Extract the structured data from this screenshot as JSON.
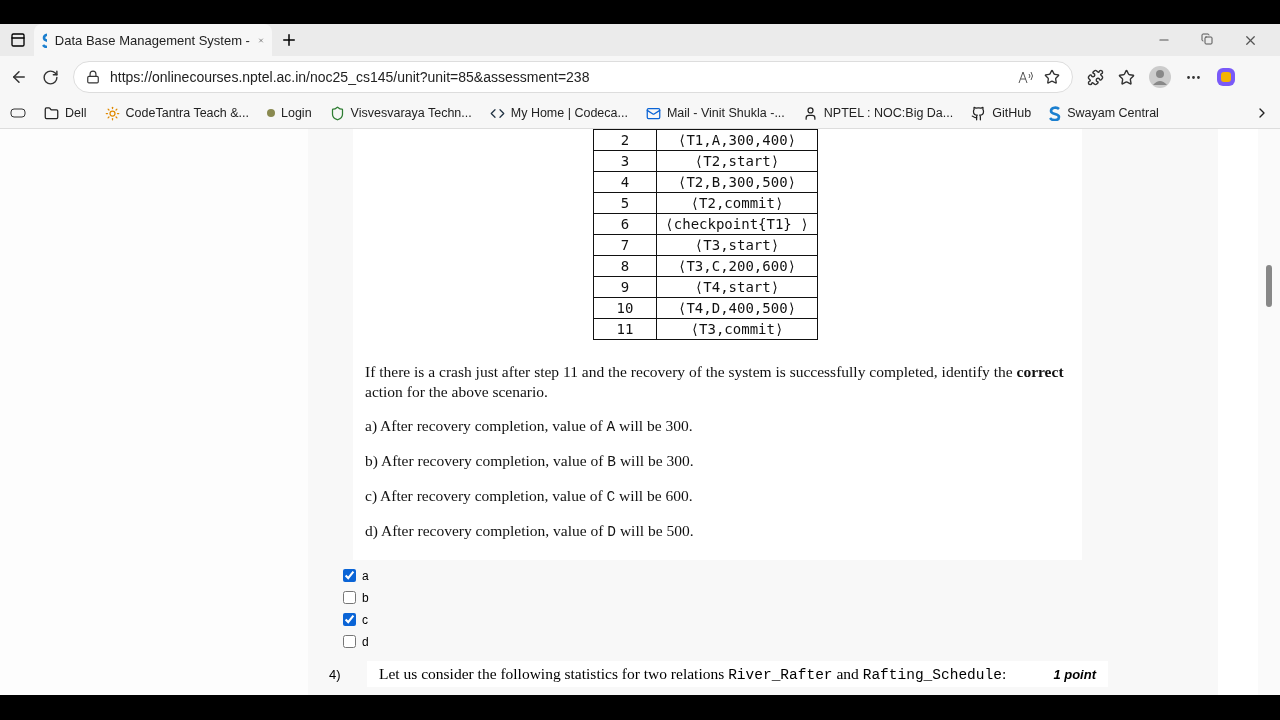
{
  "tab": {
    "title": "Data Base Management System -"
  },
  "address": {
    "url": "https://onlinecourses.nptel.ac.in/noc25_cs145/unit?unit=85&assessment=238"
  },
  "bookmarks": [
    {
      "label": "Dell",
      "kind": "folder"
    },
    {
      "label": "CodeTantra Teach &...",
      "kind": "sun"
    },
    {
      "label": "Login",
      "kind": "dot"
    },
    {
      "label": "Visvesvaraya Techn...",
      "kind": "emblem"
    },
    {
      "label": "My Home | Codeca...",
      "kind": "code"
    },
    {
      "label": "Mail - Vinit Shukla -...",
      "kind": "mail"
    },
    {
      "label": "NPTEL : NOC:Big Da...",
      "kind": "figure"
    },
    {
      "label": "GitHub",
      "kind": "github"
    },
    {
      "label": "Swayam Central",
      "kind": "s"
    }
  ],
  "log_table": {
    "rows": [
      {
        "step": "2",
        "record": "⟨T1,A,300,400⟩"
      },
      {
        "step": "3",
        "record": "⟨T2,start⟩"
      },
      {
        "step": "4",
        "record": "⟨T2,B,300,500⟩"
      },
      {
        "step": "5",
        "record": "⟨T2,commit⟩"
      },
      {
        "step": "6",
        "record": "⟨checkpoint{T1} ⟩"
      },
      {
        "step": "7",
        "record": "⟨T3,start⟩"
      },
      {
        "step": "8",
        "record": "⟨T3,C,200,600⟩"
      },
      {
        "step": "9",
        "record": "⟨T4,start⟩"
      },
      {
        "step": "10",
        "record": "⟨T4,D,400,500⟩"
      },
      {
        "step": "11",
        "record": "⟨T3,commit⟩"
      }
    ]
  },
  "question_text": "If there is a crash just after step 11 and the recovery of the system is successfully completed, identify the **correct** action for the above scenario.",
  "options": [
    {
      "label": "a)",
      "parts": [
        {
          "kind": "text",
          "text": "After recovery completion, value of "
        },
        {
          "kind": "code",
          "text": "A"
        },
        {
          "kind": "text",
          "text": " will be 300."
        }
      ]
    },
    {
      "label": "b)",
      "parts": [
        {
          "kind": "text",
          "text": "After recovery completion, value of "
        },
        {
          "kind": "code",
          "text": "B"
        },
        {
          "kind": "text",
          "text": " will be 300."
        }
      ]
    },
    {
      "label": "c)",
      "parts": [
        {
          "kind": "text",
          "text": "After recovery completion, value of "
        },
        {
          "kind": "code",
          "text": "C"
        },
        {
          "kind": "text",
          "text": " will be 600."
        }
      ]
    },
    {
      "label": "d)",
      "parts": [
        {
          "kind": "text",
          "text": "After recovery completion, value of "
        },
        {
          "kind": "code",
          "text": "D"
        },
        {
          "kind": "text",
          "text": " will be 500."
        }
      ]
    }
  ],
  "answers": [
    {
      "label": "a",
      "checked": true
    },
    {
      "label": "b",
      "checked": false
    },
    {
      "label": "c",
      "checked": true
    },
    {
      "label": "d",
      "checked": false
    }
  ],
  "next_question": {
    "number": "4)",
    "points": "1 point",
    "parts": [
      {
        "kind": "text",
        "text": "Let us consider the following statistics for two relations "
      },
      {
        "kind": "code",
        "text": "River_Rafter"
      },
      {
        "kind": "text",
        "text": " and "
      },
      {
        "kind": "code",
        "text": "Rafting_Schedule"
      },
      {
        "kind": "text",
        "text": ":"
      }
    ]
  }
}
